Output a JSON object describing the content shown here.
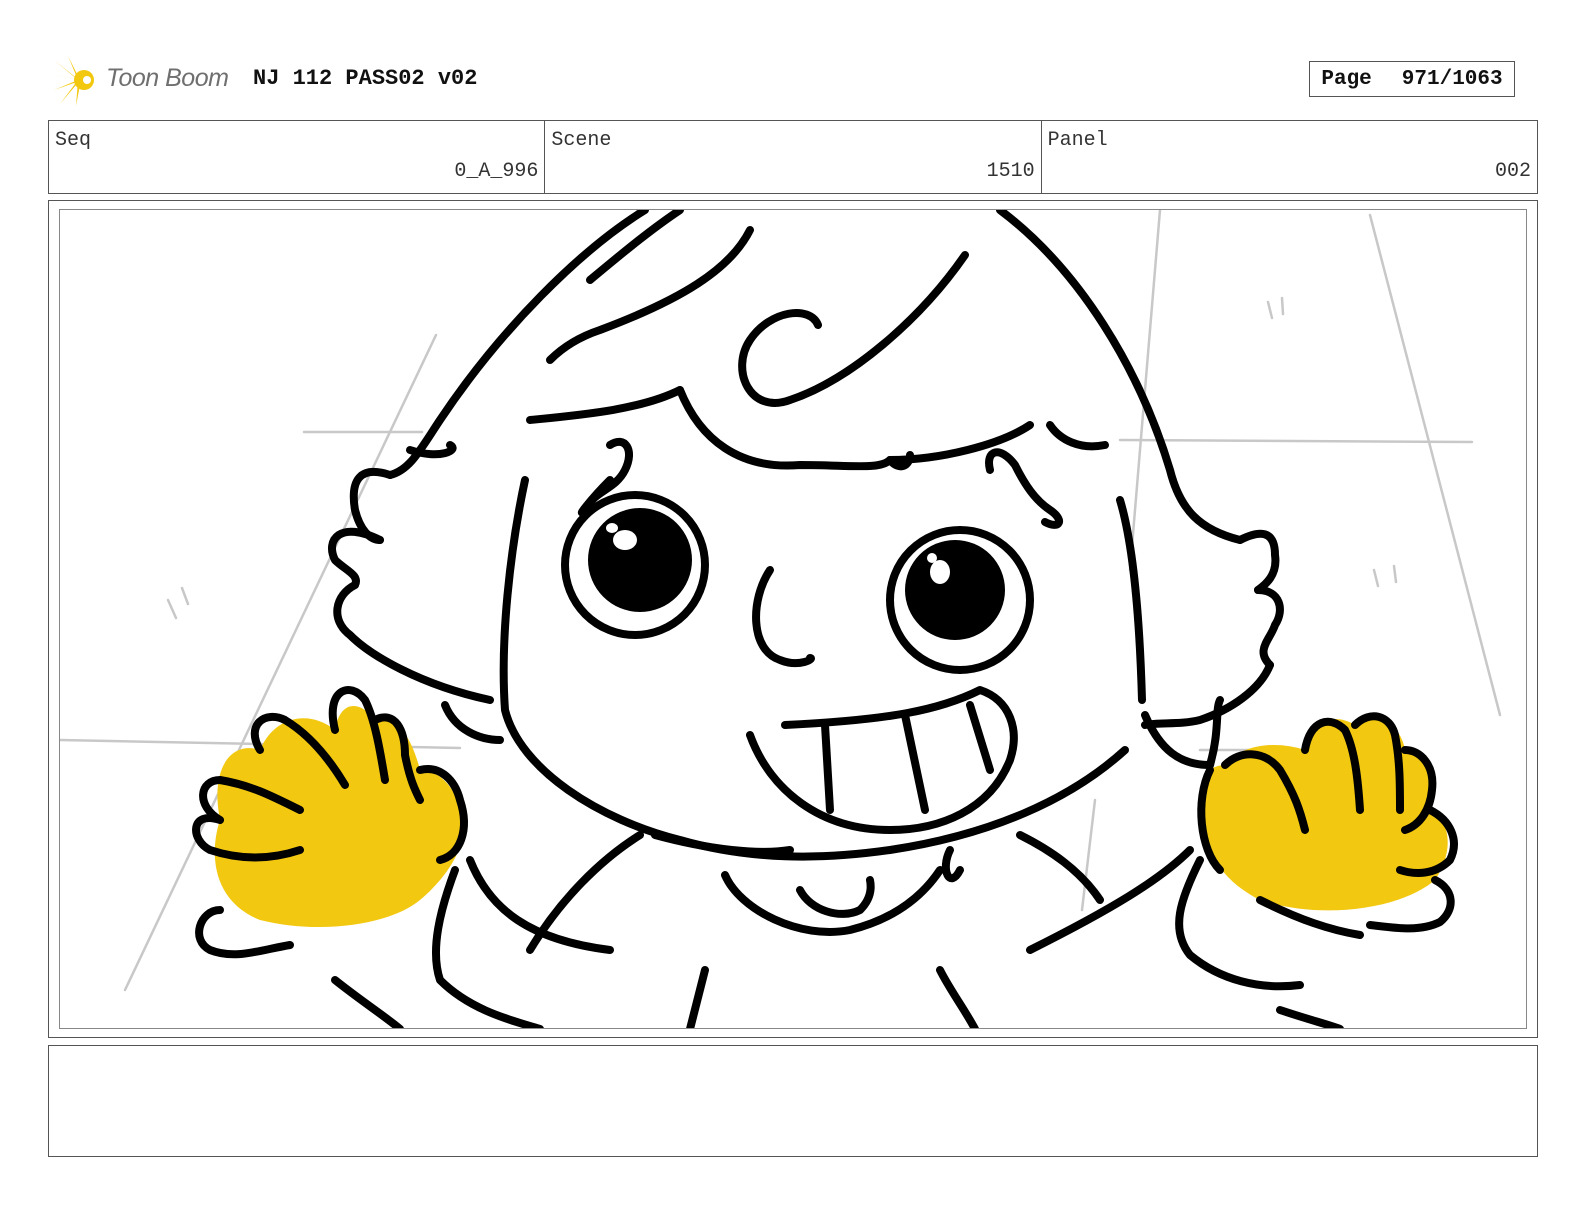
{
  "header": {
    "logo_text": "Toon Boom",
    "title": "NJ 112 PASS02 v02",
    "page_label": "Page",
    "page_value": "971/1063"
  },
  "info": {
    "seq_label": "Seq",
    "seq_value": "0_A_996",
    "scene_label": "Scene",
    "scene_value": "1510",
    "panel_label": "Panel",
    "panel_value": "002"
  },
  "notes": {
    "text": ""
  },
  "colors": {
    "accent_yellow": "#f2c811",
    "ink": "#000000",
    "frame": "#555555",
    "logo_gray": "#6f6f6f"
  },
  "icons": {
    "logo": "toon-boom-starburst-icon"
  }
}
